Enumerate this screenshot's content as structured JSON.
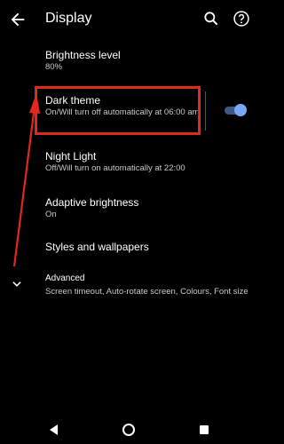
{
  "header": {
    "title": "Display"
  },
  "settings": {
    "brightness": {
      "title": "Brightness level",
      "summary": "80%"
    },
    "dark_theme": {
      "title": "Dark theme",
      "summary": "On/Will turn off automatically at 06:00 am",
      "toggle_on": true
    },
    "night_light": {
      "title": "Night Light",
      "summary": "Off/Will turn on automatically at 22:00"
    },
    "adaptive": {
      "title": "Adaptive brightness",
      "summary": "On"
    },
    "styles": {
      "title": "Styles and wallpapers"
    },
    "advanced": {
      "title": "Advanced",
      "summary": "Screen timeout, Auto-rotate screen, Colours, Font size"
    }
  },
  "icons": {
    "back": "arrow-back-icon",
    "search": "search-icon",
    "help": "help-icon",
    "expand": "chevron-down-icon",
    "nav_back": "triangle-back-icon",
    "nav_home": "circle-home-icon",
    "nav_recents": "square-recents-icon"
  },
  "colors": {
    "background": "#000000",
    "highlight": "#e2271d",
    "toggle_thumb": "#7aa7f7",
    "toggle_track": "#3d5a86"
  }
}
